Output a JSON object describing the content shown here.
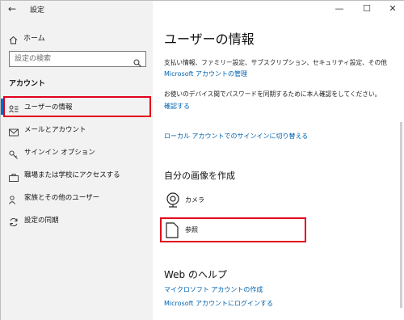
{
  "window": {
    "title": "設定",
    "controls": {
      "minimize": "—",
      "maximize": "☐",
      "close": "✕"
    }
  },
  "sidebar": {
    "home_label": "ホーム",
    "search_placeholder": "設定の検索",
    "section_label": "アカウント",
    "items": [
      {
        "label": "ユーザーの情報",
        "icon": "user-info-icon",
        "selected": true
      },
      {
        "label": "メールとアカウント",
        "icon": "mail-icon"
      },
      {
        "label": "サインイン オプション",
        "icon": "key-icon"
      },
      {
        "label": "職場または学校にアクセスする",
        "icon": "briefcase-icon"
      },
      {
        "label": "家族とその他のユーザー",
        "icon": "people-icon"
      },
      {
        "label": "設定の同期",
        "icon": "sync-icon"
      }
    ]
  },
  "main": {
    "title": "ユーザーの情報",
    "billing_desc": "支払い情報、ファミリー設定、サブスクリプション、セキュリティ設定、その他",
    "manage_link": "Microsoft アカウントの管理",
    "verify_desc": "お使いのデバイス間でパスワードを同期するために本人確認をしてください。",
    "verify_link": "確認する",
    "local_link": "ローカル アカウントでのサインインに切り替える",
    "create_pic_heading": "自分の画像を作成",
    "camera_label": "カメラ",
    "browse_label": "参照",
    "web_help_heading": "Web のヘルプ",
    "help_links": [
      "マイクロソフト アカウントの作成",
      "Microsoft アカウントにログインする"
    ]
  },
  "colors": {
    "accent": "#0063b1",
    "highlight": "#e3001b"
  }
}
